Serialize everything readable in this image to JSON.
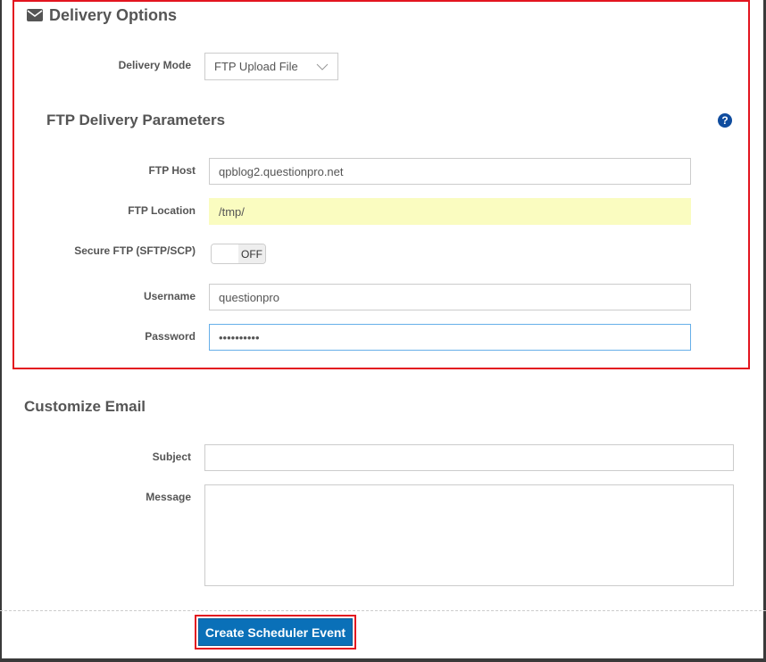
{
  "delivery": {
    "title": "Delivery Options",
    "icon": "envelope-icon",
    "mode_label": "Delivery Mode",
    "mode_value": "FTP Upload File"
  },
  "ftp": {
    "title": "FTP Delivery Parameters",
    "help_icon": "?",
    "host_label": "FTP Host",
    "host_value": "qpblog2.questionpro.net",
    "location_label": "FTP Location",
    "location_value": "/tmp/",
    "secure_label": "Secure FTP (SFTP/SCP)",
    "secure_state": "OFF",
    "username_label": "Username",
    "username_value": "questionpro",
    "password_label": "Password",
    "password_value": "••••••••••"
  },
  "email": {
    "title": "Customize Email",
    "subject_label": "Subject",
    "subject_value": "",
    "message_label": "Message",
    "message_value": ""
  },
  "actions": {
    "create_label": "Create Scheduler Event"
  },
  "colors": {
    "highlight": "#e3151f",
    "button": "#0a70b8",
    "location_bg": "#fafcc0"
  }
}
